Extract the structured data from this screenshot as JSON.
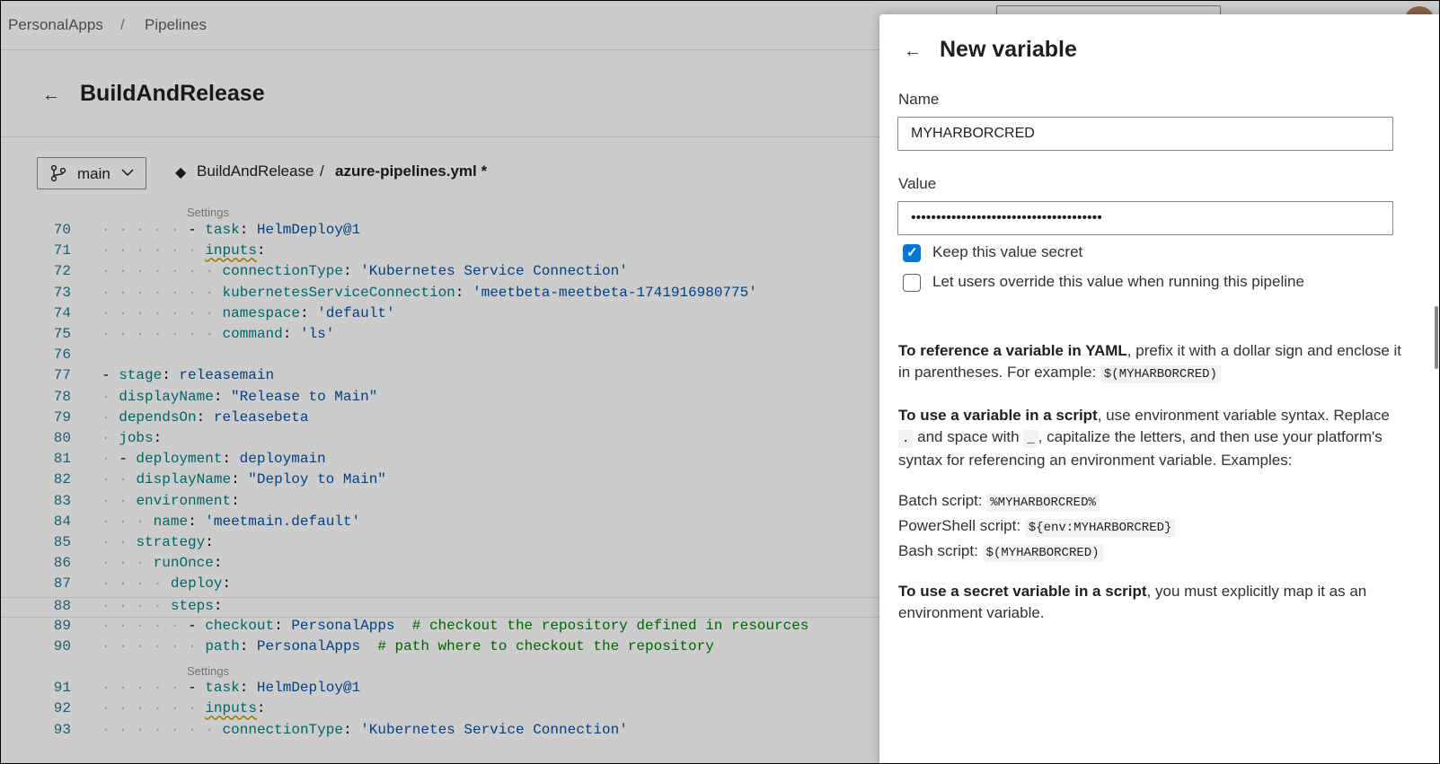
{
  "header": {
    "breadcrumb": [
      "PersonalApps",
      "/",
      "Pipelines"
    ]
  },
  "page": {
    "title": "BuildAndRelease"
  },
  "branchbar": {
    "branch": "main",
    "repo": "BuildAndRelease",
    "separator": "/",
    "file": "azure-pipelines.yml *"
  },
  "editor": {
    "codelens": "Settings",
    "lines": [
      {
        "n": "70",
        "ind": 5,
        "html": "<span class=\"pn\">- </span><span class=\"k\">task</span><span class=\"pn\">: </span><span class=\"kw\">HelmDeploy@1</span>"
      },
      {
        "n": "71",
        "ind": 6,
        "html": "<span class=\"k squig\">inputs</span><span class=\"pn\">:</span>"
      },
      {
        "n": "72",
        "ind": 7,
        "html": "<span class=\"k\">connectionType</span><span class=\"pn\">: </span><span class=\"s\">'Kubernetes Service Connection'</span>"
      },
      {
        "n": "73",
        "ind": 7,
        "html": "<span class=\"k\">kubernetesServiceConnection</span><span class=\"pn\">: </span><span class=\"s\">'meetbeta-meetbeta-1741916980775'</span>"
      },
      {
        "n": "74",
        "ind": 7,
        "html": "<span class=\"k\">namespace</span><span class=\"pn\">: </span><span class=\"s\">'default'</span>"
      },
      {
        "n": "75",
        "ind": 7,
        "html": "<span class=\"k\">command</span><span class=\"pn\">: </span><span class=\"s\">'ls'</span>"
      },
      {
        "n": "76",
        "ind": 0,
        "html": ""
      },
      {
        "n": "77",
        "ind": 0,
        "html": "<span class=\"pn\">- </span><span class=\"k\">stage</span><span class=\"pn\">: </span><span class=\"kw\">releasemain</span>"
      },
      {
        "n": "78",
        "ind": 1,
        "html": "<span class=\"k\">displayName</span><span class=\"pn\">: </span><span class=\"s\">\"Release to Main\"</span>"
      },
      {
        "n": "79",
        "ind": 1,
        "html": "<span class=\"k\">dependsOn</span><span class=\"pn\">: </span><span class=\"kw\">releasebeta</span>"
      },
      {
        "n": "80",
        "ind": 1,
        "html": "<span class=\"k\">jobs</span><span class=\"pn\">:</span>"
      },
      {
        "n": "81",
        "ind": 1,
        "html": "<span class=\"pn\">- </span><span class=\"k\">deployment</span><span class=\"pn\">: </span><span class=\"kw\">deploymain</span>"
      },
      {
        "n": "82",
        "ind": 2,
        "html": "<span class=\"k\">displayName</span><span class=\"pn\">: </span><span class=\"s\">\"Deploy to Main\"</span>"
      },
      {
        "n": "83",
        "ind": 2,
        "html": "<span class=\"k\">environment</span><span class=\"pn\">:</span>"
      },
      {
        "n": "84",
        "ind": 3,
        "html": "<span class=\"k\">name</span><span class=\"pn\">: </span><span class=\"s\">'meetmain.default'</span>"
      },
      {
        "n": "85",
        "ind": 2,
        "html": "<span class=\"k\">strategy</span><span class=\"pn\">:</span>"
      },
      {
        "n": "86",
        "ind": 3,
        "html": "<span class=\"k\">runOnce</span><span class=\"pn\">:</span>"
      },
      {
        "n": "87",
        "ind": 4,
        "html": "<span class=\"k\">deploy</span><span class=\"pn\">:</span>"
      },
      {
        "n": "88",
        "ind": 4,
        "html": "<span class=\"k\">steps</span><span class=\"pn\">:</span>"
      },
      {
        "n": "89",
        "ind": 5,
        "html": "<span class=\"pn\">- </span><span class=\"k\">checkout</span><span class=\"pn\">: </span><span class=\"kw\">PersonalApps</span><span class=\"cm\">  # checkout the repository defined in resources</span>"
      },
      {
        "n": "90",
        "ind": 6,
        "html": "<span class=\"k\">path</span><span class=\"pn\">: </span><span class=\"kw\">PersonalApps</span><span class=\"cm\">  # path where to checkout the repository</span>"
      },
      {
        "n": "91",
        "ind": 5,
        "html": "<span class=\"pn\">- </span><span class=\"k\">task</span><span class=\"pn\">: </span><span class=\"kw\">HelmDeploy@1</span>"
      },
      {
        "n": "92",
        "ind": 6,
        "html": "<span class=\"k squig\">inputs</span><span class=\"pn\">:</span>"
      },
      {
        "n": "93",
        "ind": 7,
        "html": "<span class=\"k\">connectionType</span><span class=\"pn\">: </span><span class=\"s\">'Kubernetes Service Connection'</span>"
      }
    ]
  },
  "panel": {
    "title": "New variable",
    "name_label": "Name",
    "name_value": "MYHARBORCRED",
    "value_label": "Value",
    "value_masked": "••••••••••••••••••••••••••••••••••••••",
    "keep_secret_label": "Keep this value secret",
    "keep_secret_checked": true,
    "override_label": "Let users override this value when running this pipeline",
    "override_checked": false,
    "help_yaml_bold": "To reference a variable in YAML",
    "help_yaml_text": ", prefix it with a dollar sign and enclose it in parentheses. For example: ",
    "help_yaml_code": "$(MYHARBORCRED)",
    "help_script_bold": "To use a variable in a script",
    "help_script_text1": ", use environment variable syntax. Replace ",
    "help_script_code1": ".",
    "help_script_text2": " and space with ",
    "help_script_code2": "_",
    "help_script_text3": ", capitalize the letters, and then use your platform's syntax for referencing an environment variable. Examples:",
    "batch_label": "Batch script: ",
    "batch_code": "%MYHARBORCRED%",
    "ps_label": "PowerShell script: ",
    "ps_code": "${env:MYHARBORCRED}",
    "bash_label": "Bash script: ",
    "bash_code": "$(MYHARBORCRED)",
    "help_secret_bold": "To use a secret variable in a script",
    "help_secret_text": ", you must explicitly map it as an environment variable."
  }
}
